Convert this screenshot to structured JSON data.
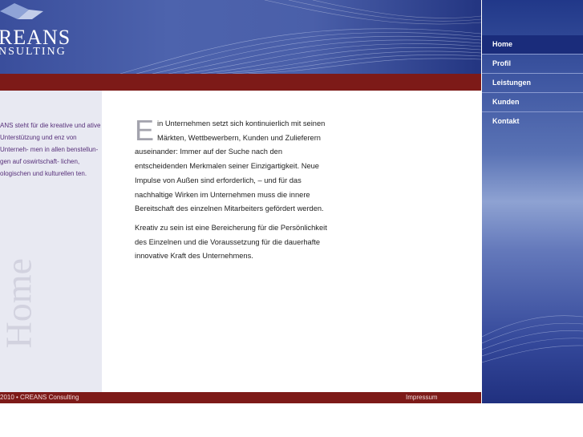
{
  "logo": {
    "line1": "REANS",
    "line2": "NSULTING"
  },
  "left_column": {
    "text": "ANS steht für die kreative und ative Unterstützung und enz von Unterneh- men in allen benstellun- gen auf oswirtschaft- lichen, ologischen und kulturellen ten.",
    "watermark": "Home"
  },
  "article": {
    "dropcap": "E",
    "paragraph1": "in Unternehmen setzt sich kontinuierlich mit seinen Märkten, Wettbewerbern, Kunden und Zulieferern auseinander: Immer auf der Suche nach den entscheidenden Merkmalen  seiner Einzigartigkeit. Neue Impulse von Außen sind erforderlich, – und für das nachhaltige Wirken im Unternehmen muss  die innere Bereitschaft des einzelnen  Mitarbeiters gefördert werden.",
    "paragraph2": "Kreativ zu sein ist eine Bereicherung für die Persönlichkeit des Einzelnen und die Voraussetzung für die dauerhafte innovative Kraft des Unternehmens."
  },
  "footer": {
    "copyright": "2010 • CREANS Consulting",
    "impressum": "Impressum"
  },
  "nav": {
    "items": [
      {
        "label": "Home",
        "active": true
      },
      {
        "label": "Profil"
      },
      {
        "label": "Leistungen"
      },
      {
        "label": "Kunden"
      },
      {
        "label": "Kontakt"
      }
    ]
  },
  "colors": {
    "header_blue": "#4d63ad",
    "bar_red": "#7d1a18",
    "nav_active": "#1a2c7b",
    "side_text": "#57307a"
  }
}
